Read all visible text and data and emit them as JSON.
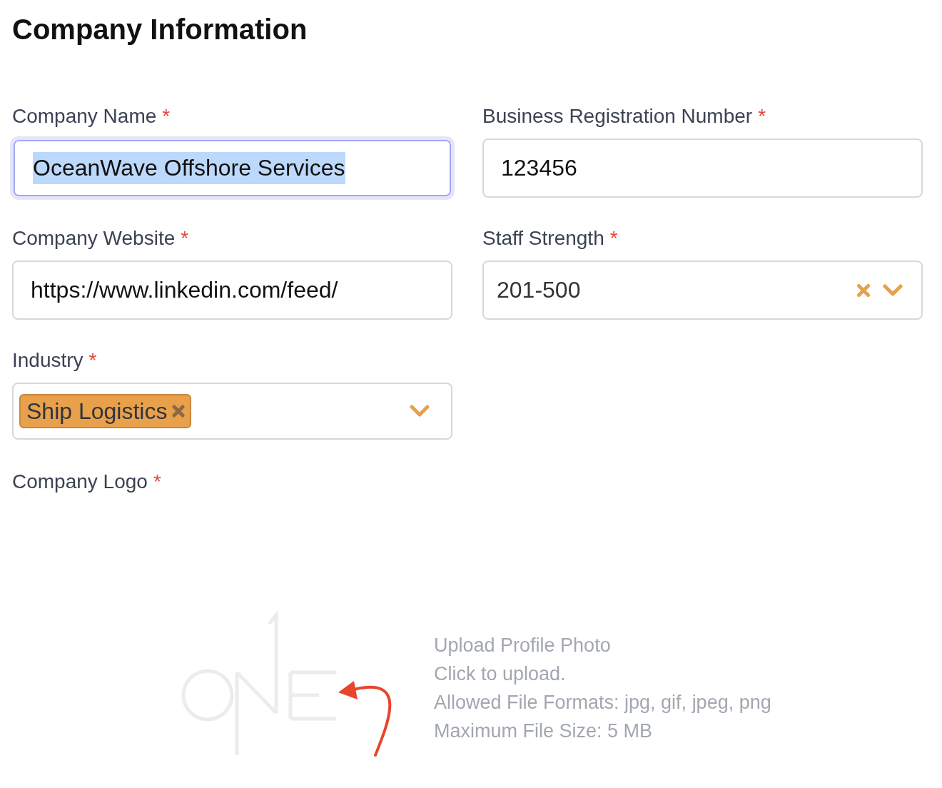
{
  "title": "Company Information",
  "fields": [
    {
      "kind": "text",
      "label": "Company Name",
      "required_mark": "*",
      "value": "OceanWave Offshore Services",
      "focused": true,
      "text_selected": true
    },
    {
      "kind": "text",
      "label": "Business Registration Number",
      "required_mark": "*",
      "value": "123456",
      "focused": false,
      "text_selected": false
    },
    {
      "kind": "text",
      "label": "Company Website",
      "required_mark": "*",
      "value": "https://www.linkedin.com/feed/",
      "focused": false,
      "text_selected": false
    },
    {
      "kind": "select",
      "label": "Staff Strength",
      "required_mark": "*",
      "value": "201-500",
      "clearable": true
    },
    {
      "kind": "multiselect",
      "label": "Industry",
      "required_mark": "*",
      "tags": [
        "Ship Logistics"
      ]
    }
  ],
  "logo_upload": {
    "label": "Company Logo",
    "required_mark": "*",
    "lines": [
      "Upload Profile Photo",
      "Click to upload.",
      "Allowed File Formats: jpg, gif, jpeg, png",
      "Maximum File Size: 5 MB"
    ]
  }
}
